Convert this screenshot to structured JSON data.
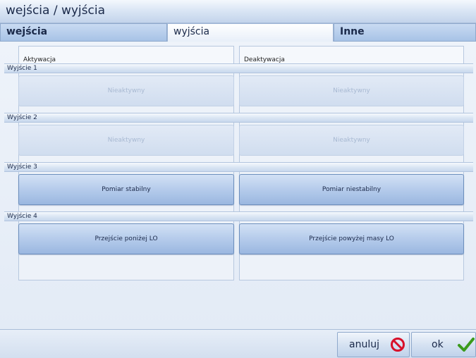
{
  "window": {
    "title": "wejścia / wyjścia"
  },
  "tabs": [
    {
      "label": "wejścia"
    },
    {
      "label": "wyjścia"
    },
    {
      "label": "Inne"
    }
  ],
  "columns": {
    "activation": "Aktywacja",
    "deactivation": "Deaktywacja"
  },
  "outputs": [
    {
      "title": "Wyjście 1",
      "activation": "Nieaktywny",
      "deactivation": "Nieaktywny",
      "enabled": false
    },
    {
      "title": "Wyjście 2",
      "activation": "Nieaktywny",
      "deactivation": "Nieaktywny",
      "enabled": false
    },
    {
      "title": "Wyjście 3",
      "activation": "Pomiar stabilny",
      "deactivation": "Pomiar niestabilny",
      "enabled": true
    },
    {
      "title": "Wyjście 4",
      "activation": "Przejście poniżej LO",
      "deactivation": "Przejście powyżej masy LO",
      "enabled": true
    }
  ],
  "footer": {
    "cancel_label": "anuluj",
    "ok_label": "ok"
  },
  "icons": {
    "cancel": "no-entry-icon",
    "ok": "checkmark-icon"
  },
  "colors": {
    "cancel_icon": "#d8102a",
    "ok_icon": "#3a9a1c"
  }
}
